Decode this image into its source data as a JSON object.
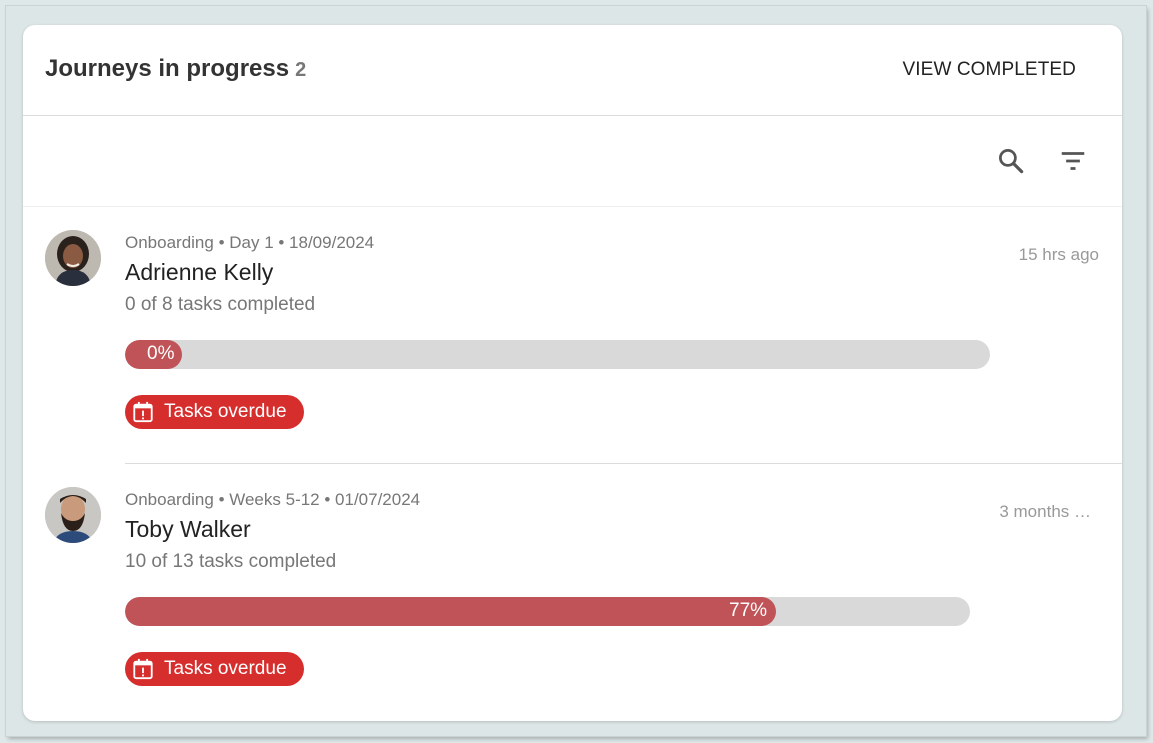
{
  "header": {
    "title": "Journeys in progress",
    "count": "2",
    "view_completed_label": "VIEW COMPLETED"
  },
  "toolbar": {
    "search_icon": "search-icon",
    "filter_icon": "filter-icon"
  },
  "colors": {
    "progress_fill": "#c05357",
    "progress_track": "#d9d9d9",
    "badge_overdue": "#d62d2d"
  },
  "journeys": [
    {
      "meta": "Onboarding • Day 1 • 18/09/2024",
      "name": "Adrienne Kelly",
      "tasks": "0 of 8 tasks completed",
      "time": "15 hrs ago",
      "progress": 0,
      "progress_label": "0%",
      "badge": "Tasks overdue"
    },
    {
      "meta": "Onboarding • Weeks 5-12 • 01/07/2024",
      "name": "Toby Walker",
      "tasks": "10 of 13 tasks completed",
      "time": "3 months …",
      "progress": 77,
      "progress_label": "77%",
      "badge": "Tasks overdue"
    }
  ]
}
